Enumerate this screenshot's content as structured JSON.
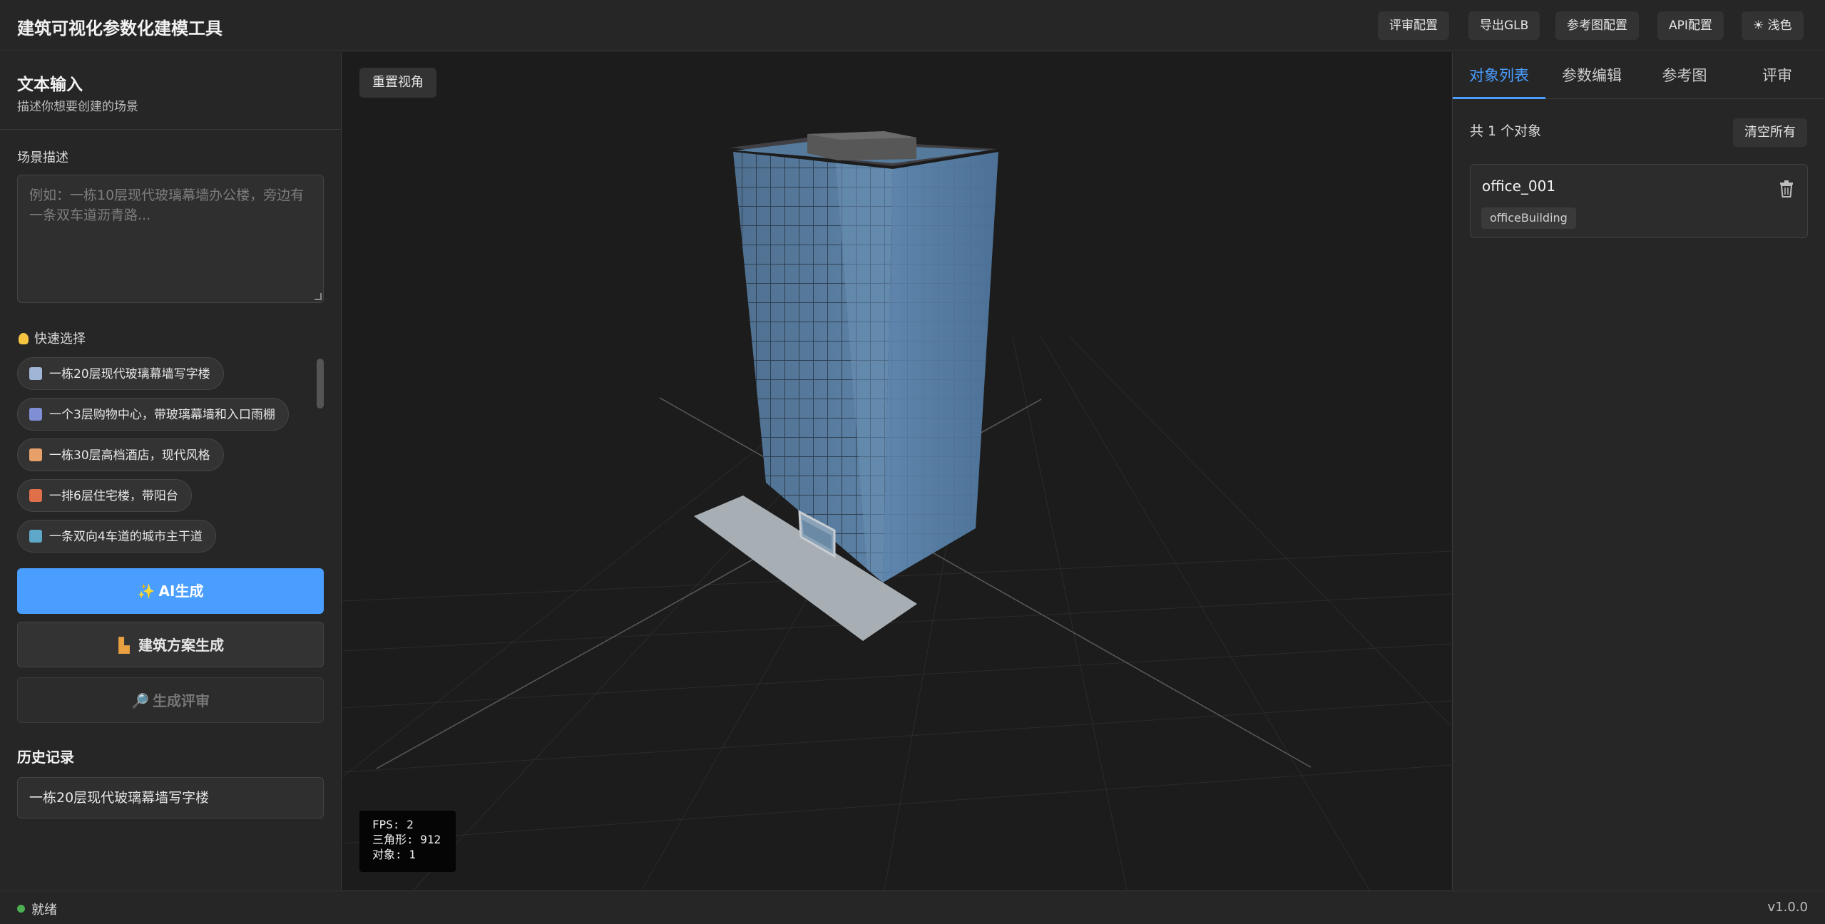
{
  "header": {
    "title": "建筑可视化参数化建模工具",
    "buttons": [
      "评审配置",
      "导出GLB",
      "参考图配置",
      "API配置",
      "☀ 浅色"
    ]
  },
  "left": {
    "title": "文本输入",
    "subtitle": "描述你想要创建的场景",
    "scene_label": "场景描述",
    "scene_placeholder": "例如：一栋10层现代玻璃幕墙办公楼，旁边有一条双车道沥青路...",
    "quick_label": "快速选择",
    "quick_items": [
      {
        "icon": "office-building-icon",
        "label": "一栋20层现代玻璃幕墙写字楼"
      },
      {
        "icon": "shopping-mall-icon",
        "label": "一个3层购物中心，带玻璃幕墙和入口雨棚"
      },
      {
        "icon": "hotel-icon",
        "label": "一栋30层高档酒店，现代风格"
      },
      {
        "icon": "house-icon",
        "label": "一排6层住宅楼，带阳台"
      },
      {
        "icon": "road-icon",
        "label": "一条双向4车道的城市主干道"
      }
    ],
    "ai_button": "AI生成",
    "arch_button": "建筑方案生成",
    "review_button": "生成评审",
    "history_title": "历史记录",
    "history_items": [
      "一栋20层现代玻璃幕墙写字楼"
    ]
  },
  "viewport": {
    "reset_button": "重置视角",
    "stats": {
      "fps": "FPS: 2",
      "triangles": "三角形: 912",
      "objects": "对象: 1"
    }
  },
  "right": {
    "tabs": [
      "对象列表",
      "参数编辑",
      "参考图",
      "评审"
    ],
    "active_tab": 0,
    "object_count": "共 1 个对象",
    "clear_button": "清空所有",
    "objects": [
      {
        "name": "office_001",
        "type": "officeBuilding"
      }
    ]
  },
  "status": {
    "text": "就绪",
    "version": "v1.0.0"
  },
  "colors": {
    "accent": "#4a9eff",
    "ready": "#4caf50",
    "background": "#1e1e1e"
  }
}
